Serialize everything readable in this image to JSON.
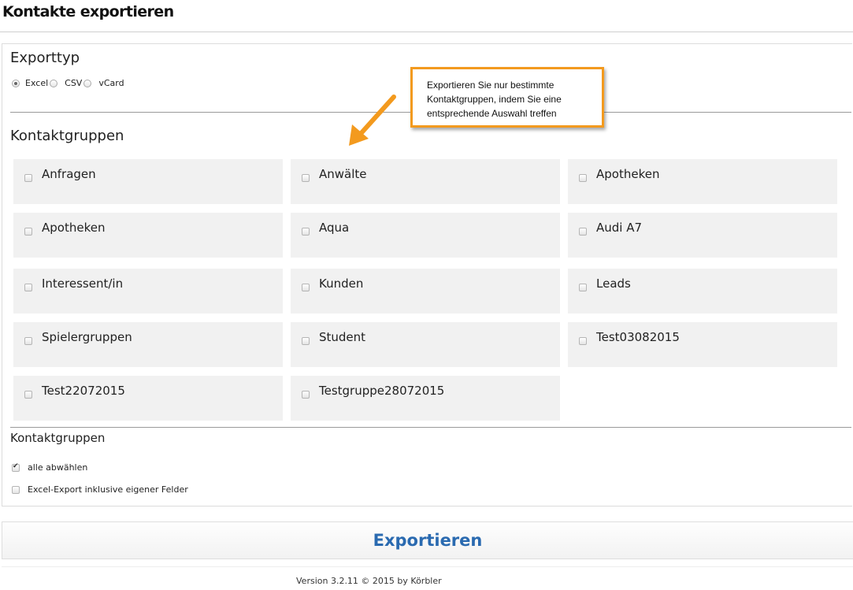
{
  "page": {
    "title": "Kontakte exportieren"
  },
  "export_type": {
    "heading": "Exporttyp",
    "options": [
      {
        "label": "Excel",
        "checked": true
      },
      {
        "label": "CSV",
        "checked": false
      },
      {
        "label": "vCard",
        "checked": false
      }
    ]
  },
  "tooltip": {
    "text": "Exportieren Sie nur bestimmte Kontaktgruppen, indem Sie eine entsprechende Auswahl treffen"
  },
  "groups": {
    "heading": "Kontaktgruppen",
    "items": [
      {
        "label": "Anfragen"
      },
      {
        "label": "Anwälte"
      },
      {
        "label": "Apotheken"
      },
      {
        "label": "Apotheken"
      },
      {
        "label": "Aqua"
      },
      {
        "label": "Audi A7"
      },
      {
        "label": "Interessent/in"
      },
      {
        "label": "Kunden"
      },
      {
        "label": "Leads"
      },
      {
        "label": "Spielergruppen"
      },
      {
        "label": "Student"
      },
      {
        "label": "Test03082015"
      },
      {
        "label": "Test22072015"
      },
      {
        "label": "Testgruppe28072015"
      }
    ]
  },
  "options": {
    "heading": "Kontaktgruppen",
    "deselect_all": "alle abwählen",
    "custom_fields": "Excel-Export inklusive eigener Felder"
  },
  "actions": {
    "export_label": "Exportieren"
  },
  "footer": {
    "text": "Version 3.2.11 © 2015 by Körbler"
  },
  "colors": {
    "accent": "#2a6ab0",
    "tooltip_border": "#f39a1e",
    "card_bg": "#f1f1f1"
  }
}
